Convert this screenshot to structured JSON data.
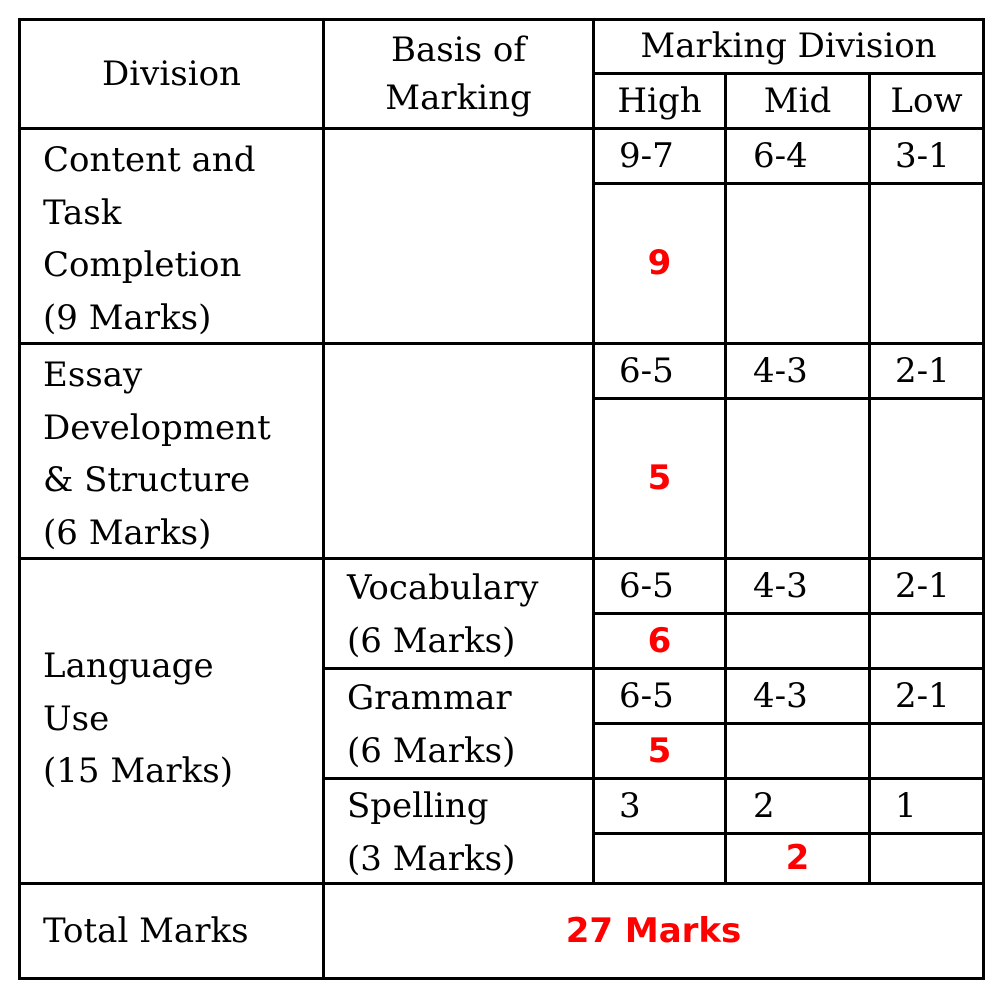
{
  "table": {
    "header": {
      "division": "Division",
      "basis_line1": "Basis of",
      "basis_line2": "Marking",
      "marking_division": "Marking Division",
      "high": "High",
      "mid": "Mid",
      "low": "Low"
    },
    "rows": [
      {
        "division_lines": [
          "Content and",
          "Task",
          "Completion",
          "(9 Marks)"
        ],
        "basis": "",
        "ranges": [
          "9-7",
          "6-4",
          "3-1"
        ],
        "score": "9",
        "score_band": "high"
      },
      {
        "division_lines": [
          "Essay",
          "Development",
          "& Structure",
          "(6 Marks)"
        ],
        "basis": "",
        "ranges": [
          "6-5",
          "4-3",
          "2-1"
        ],
        "score": "5",
        "score_band": "high"
      }
    ],
    "language_use": {
      "division_lines": [
        "Language",
        "Use",
        "(15 Marks)"
      ],
      "subrows": [
        {
          "basis_lines": [
            "Vocabulary",
            "(6 Marks)"
          ],
          "ranges": [
            "6-5",
            "4-3",
            "2-1"
          ],
          "score": "6",
          "score_band": "high"
        },
        {
          "basis_lines": [
            "Grammar",
            "(6 Marks)"
          ],
          "ranges": [
            "6-5",
            "4-3",
            "2-1"
          ],
          "score": "5",
          "score_band": "high"
        },
        {
          "basis_lines": [
            "Spelling",
            "(3 Marks)"
          ],
          "ranges": [
            "3",
            "2",
            "1"
          ],
          "score": "2",
          "score_band": "mid"
        }
      ]
    },
    "total": {
      "label": "Total Marks",
      "value": "27 Marks"
    }
  },
  "colors": {
    "score": "#ff0000",
    "border": "#000000"
  }
}
